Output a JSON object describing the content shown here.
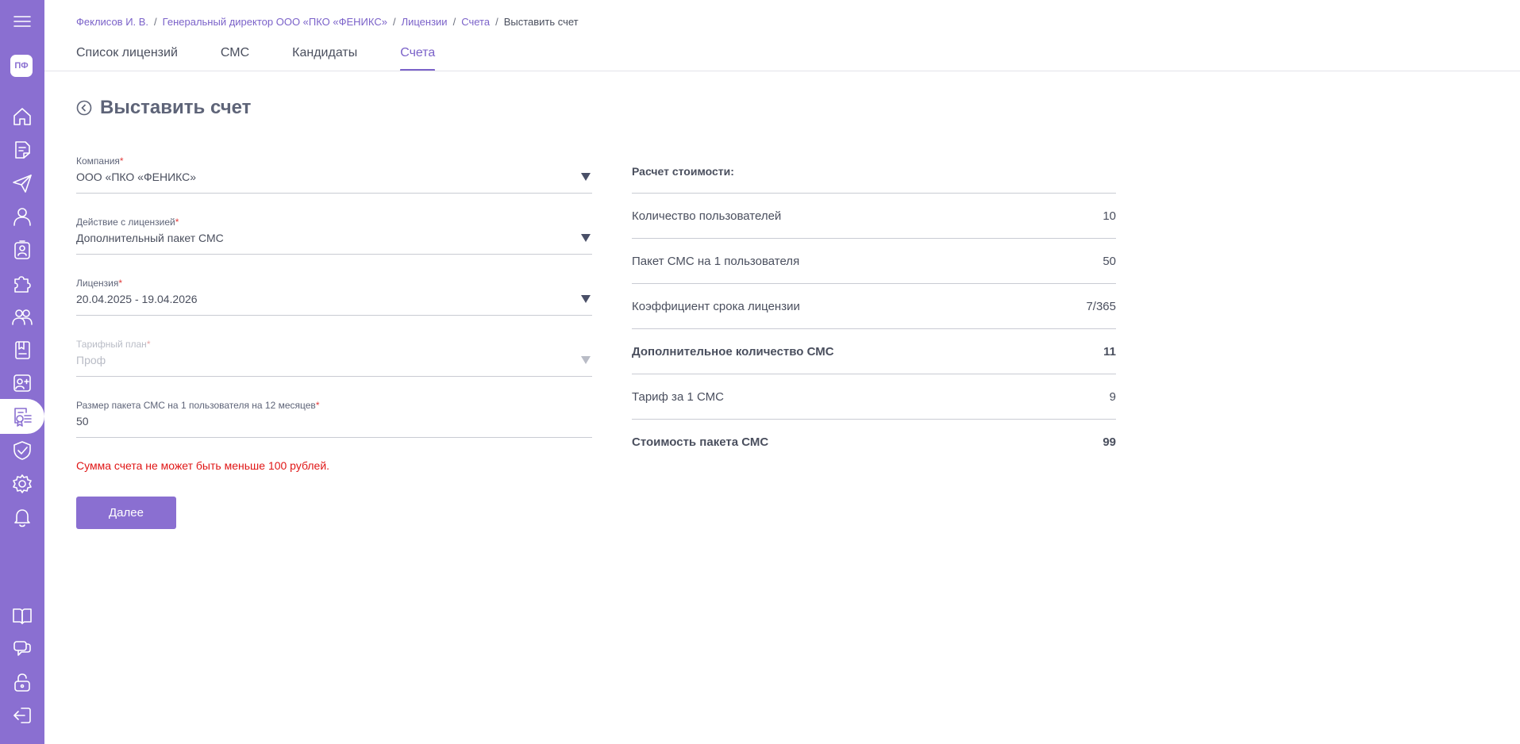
{
  "sidebar": {
    "avatar_initials": "ПФ",
    "icons_top": [
      "menu-icon"
    ],
    "icons": [
      "home-icon",
      "document-icon",
      "send-icon",
      "user-icon",
      "badge-icon",
      "puzzle-icon",
      "users-icon",
      "book-icon",
      "contact-add-icon",
      "license-icon",
      "shield-check-icon",
      "gear-icon",
      "bell-icon"
    ],
    "icons_bottom": [
      "open-book-icon",
      "chat-icon",
      "unlock-icon",
      "logout-icon"
    ],
    "active_item": "license-icon"
  },
  "breadcrumb": {
    "items": [
      "Феклисов И. В.",
      "Генеральный директор ООО «ПКО «ФЕНИКС»",
      "Лицензии",
      "Счета"
    ],
    "current": "Выставить счет"
  },
  "tabs": [
    {
      "label": "Список лицензий",
      "active": false
    },
    {
      "label": "СМС",
      "active": false
    },
    {
      "label": "Кандидаты",
      "active": false
    },
    {
      "label": "Счета",
      "active": true
    }
  ],
  "page": {
    "title": "Выставить счет"
  },
  "form": {
    "company": {
      "label": "Компания",
      "required": "*",
      "value": "ООО «ПКО «ФЕНИКС»"
    },
    "action": {
      "label": "Действие с лицензией",
      "required": "*",
      "value": "Дополнительный пакет СМС"
    },
    "license": {
      "label": "Лицензия",
      "required": "*",
      "value": "20.04.2025 - 19.04.2026"
    },
    "tariff": {
      "label": "Тарифный план",
      "required": "*",
      "value": "Проф",
      "disabled": true
    },
    "package_size": {
      "label": "Размер пакета СМС на 1 пользователя на 12 месяцев",
      "required": "*",
      "value": "50"
    },
    "error": "Сумма счета не может быть меньше 100 рублей.",
    "submit_label": "Далее"
  },
  "cost": {
    "title": "Расчет стоимости:",
    "rows": [
      {
        "label": "Количество пользователей",
        "value": "10",
        "bold": false
      },
      {
        "label": "Пакет СМС на 1 пользователя",
        "value": "50",
        "bold": false
      },
      {
        "label": "Коэффициент срока лицензии",
        "value": "7/365",
        "bold": false
      },
      {
        "label": "Дополнительное количество СМС",
        "value": "11",
        "bold": true
      },
      {
        "label": "Тариф за 1 СМС",
        "value": "9",
        "bold": false
      },
      {
        "label": "Стоимость пакета СМС",
        "value": "99",
        "bold": true
      }
    ]
  },
  "colors": {
    "accent": "#8a6fd1",
    "link": "#7b62c9",
    "error": "#e01616"
  }
}
